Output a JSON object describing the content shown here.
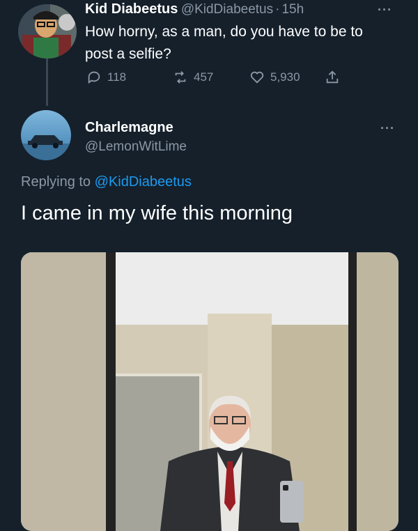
{
  "tweet": {
    "display_name": "Kid Diabeetus",
    "handle": "@KidDiabeetus",
    "separator": "·",
    "time": "15h",
    "text_line1": "How horny, as a man, do you have to be to",
    "text_line2": "post a selfie?",
    "actions": {
      "reply_count": "118",
      "retweet_count": "457",
      "like_count": "5,930"
    },
    "more": "···",
    "avatar_icon": "cartoon-avatar-icon"
  },
  "reply": {
    "display_name": "Charlemagne",
    "handle": "@LemonWitLime",
    "more": "···",
    "replying_prefix": "Replying to ",
    "replying_to": "@KidDiabeetus",
    "text": "I came in my wife this morning",
    "avatar_icon": "car-avatar-icon"
  },
  "colors": {
    "background": "#15202b",
    "secondary_text": "#8b98a5",
    "link": "#1d9bf0"
  }
}
